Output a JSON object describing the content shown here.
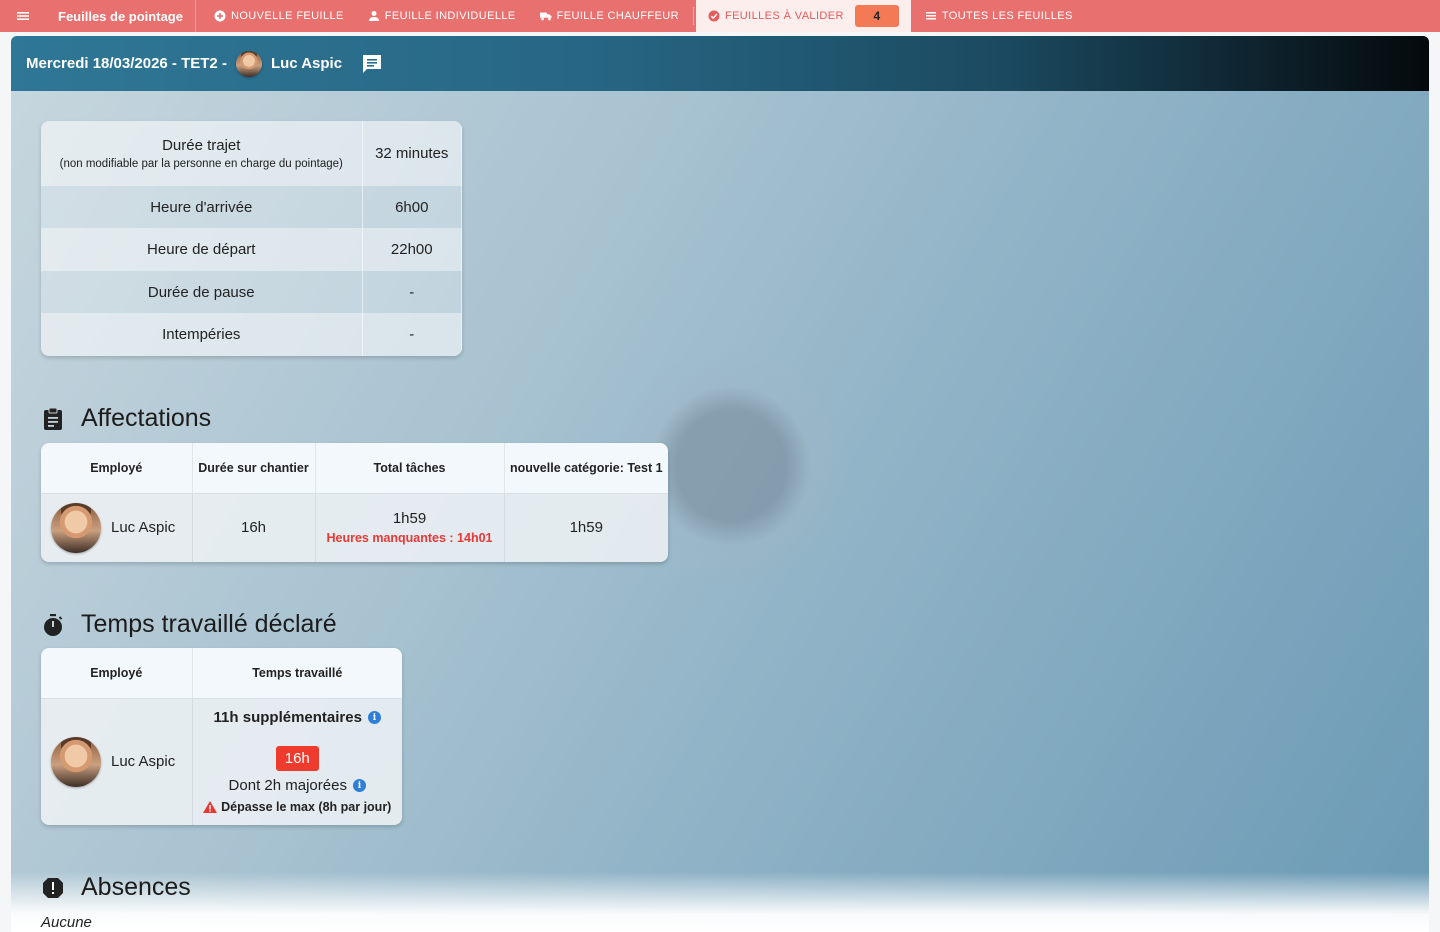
{
  "nav": {
    "title": "Feuilles de pointage",
    "items": [
      {
        "label": "Nouvelle feuille",
        "icon": "plus-circle-icon"
      },
      {
        "label": "Feuille individuelle",
        "icon": "person-icon"
      },
      {
        "label": "Feuille chauffeur",
        "icon": "truck-icon"
      },
      {
        "label": "Feuilles à valider",
        "icon": "check-circle-icon",
        "badge": "4"
      },
      {
        "label": "Toutes les feuilles",
        "icon": "list-icon"
      }
    ]
  },
  "header": {
    "title": "Mercredi 18/03/2026 - TET2 -",
    "user": "Luc Aspic"
  },
  "info": {
    "rows": [
      {
        "label": "Durée trajet",
        "sub": "(non modifiable par la personne en charge du pointage)",
        "value": "32 minutes"
      },
      {
        "label": "Heure d'arrivée",
        "value": "6h00"
      },
      {
        "label": "Heure de départ",
        "value": "22h00"
      },
      {
        "label": "Durée de pause",
        "value": "-"
      },
      {
        "label": "Intempéries",
        "value": "-"
      }
    ]
  },
  "affectations": {
    "title": "Affectations",
    "headers": [
      "Employé",
      "Durée sur chantier",
      "Total tâches",
      "nouvelle catégorie: Test 1"
    ],
    "row": {
      "employee": "Luc Aspic",
      "duree": "16h",
      "total": "1h59",
      "missing": "Heures manquantes : 14h01",
      "category": "1h59"
    }
  },
  "temps": {
    "title": "Temps travaillé déclaré",
    "headers": [
      "Employé",
      "Temps travaillé"
    ],
    "row": {
      "employee": "Luc Aspic",
      "overtime": "11h supplémentaires",
      "hours": "16h",
      "majorees": "Dont 2h majorées",
      "warning": "Dépasse le max (8h par jour)"
    }
  },
  "absences": {
    "title": "Absences",
    "value": "Aucune"
  },
  "colors": {
    "nav_bg": "#e8706f",
    "badge": "#f47a55",
    "alert_red": "#e53935",
    "hours_badge": "#ef3b2d",
    "info_blue": "#2f7fd8"
  }
}
